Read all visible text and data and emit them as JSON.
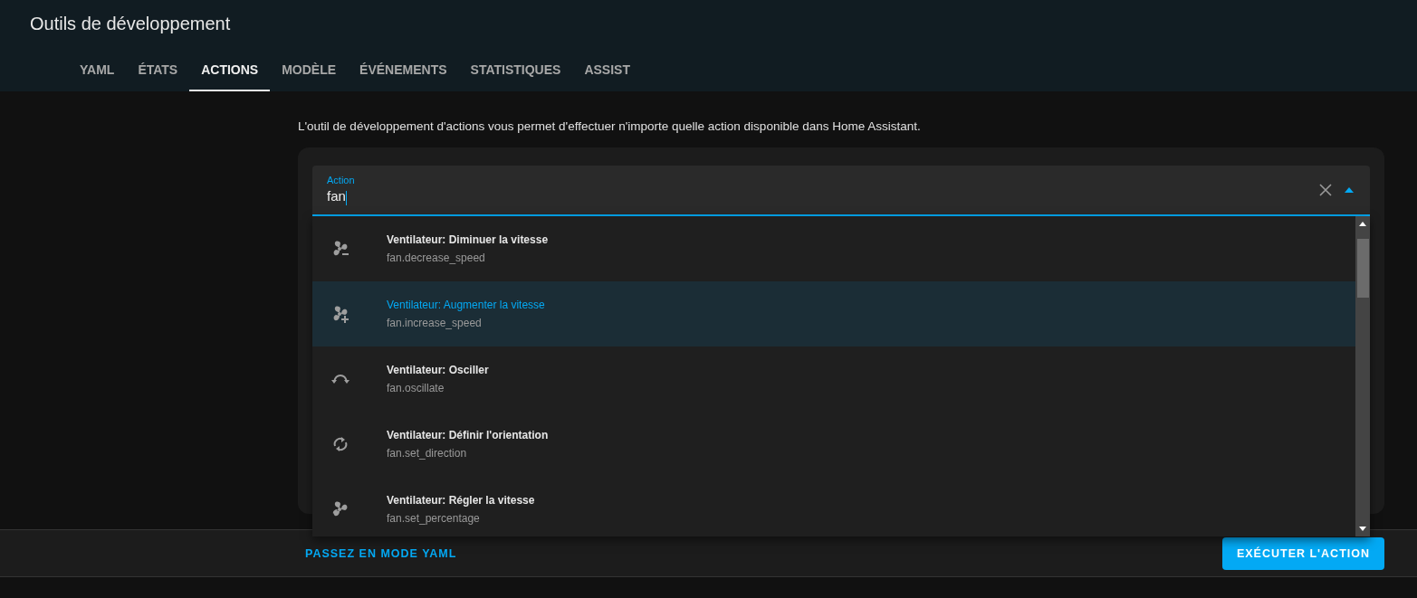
{
  "header": {
    "title": "Outils de développement"
  },
  "tabs": [
    {
      "label": "YAML",
      "selected": false
    },
    {
      "label": "ÉTATS",
      "selected": false
    },
    {
      "label": "ACTIONS",
      "selected": true
    },
    {
      "label": "MODÈLE",
      "selected": false
    },
    {
      "label": "ÉVÉNEMENTS",
      "selected": false
    },
    {
      "label": "STATISTIQUES",
      "selected": false
    },
    {
      "label": "ASSIST",
      "selected": false
    }
  ],
  "description": "L'outil de développement d'actions vous permet d'effectuer n'importe quelle action disponible dans Home Assistant.",
  "action_field": {
    "label": "Action",
    "value": "fan"
  },
  "suggestions": [
    {
      "kind": "fan-minus",
      "title": "Ventilateur: Diminuer la vitesse",
      "subtitle": "fan.decrease_speed",
      "selected": false
    },
    {
      "kind": "fan-plus",
      "title": "Ventilateur: Augmenter la vitesse",
      "subtitle": "fan.increase_speed",
      "selected": true
    },
    {
      "kind": "oscillate",
      "title": "Ventilateur: Osciller",
      "subtitle": "fan.oscillate",
      "selected": false
    },
    {
      "kind": "direction",
      "title": "Ventilateur: Définir l'orientation",
      "subtitle": "fan.set_direction",
      "selected": false
    },
    {
      "kind": "fan",
      "title": "Ventilateur: Régler la vitesse",
      "subtitle": "fan.set_percentage",
      "selected": false
    }
  ],
  "footer": {
    "yaml_link": "PASSEZ EN MODE YAML",
    "run_button": "EXÉCUTER L'ACTION"
  }
}
